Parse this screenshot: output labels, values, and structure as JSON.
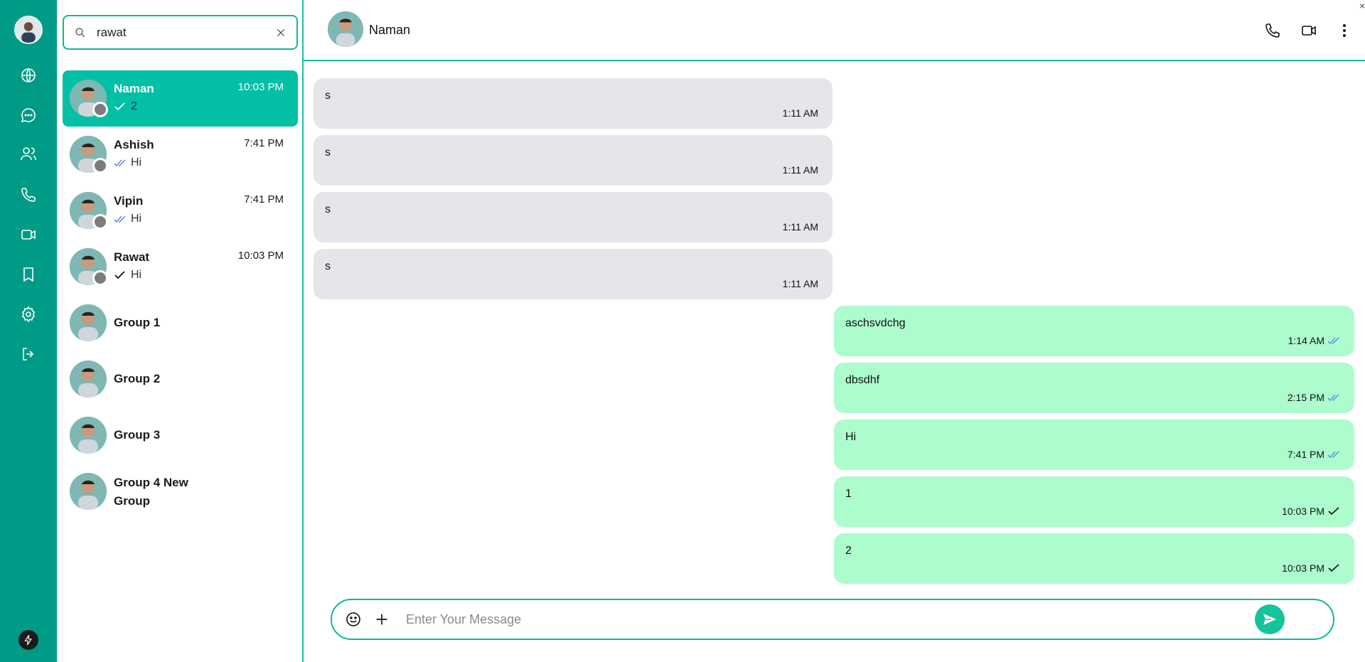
{
  "search": {
    "value": "rawat",
    "placeholder": "Search"
  },
  "chats": [
    {
      "name": "Naman",
      "time": "10:03 PM",
      "preview": "2",
      "tick": "single",
      "active": true
    },
    {
      "name": "Ashish",
      "time": "7:41 PM",
      "preview": "Hi",
      "tick": "double-blue",
      "active": false
    },
    {
      "name": "Vipin",
      "time": "7:41 PM",
      "preview": "Hi",
      "tick": "double-blue",
      "active": false
    },
    {
      "name": "Rawat",
      "time": "10:03 PM",
      "preview": "Hi",
      "tick": "single",
      "active": false
    },
    {
      "name": "Group 1"
    },
    {
      "name": "Group 2"
    },
    {
      "name": "Group 3"
    },
    {
      "name": "Group 4 New Group"
    }
  ],
  "header": {
    "name": "Naman"
  },
  "messages": [
    {
      "dir": "in",
      "text": "s",
      "time": "1:11 AM"
    },
    {
      "dir": "in",
      "text": "s",
      "time": "1:11 AM"
    },
    {
      "dir": "in",
      "text": "s",
      "time": "1:11 AM"
    },
    {
      "dir": "in",
      "text": "s",
      "time": "1:11 AM"
    },
    {
      "dir": "out",
      "text": "aschsvdchg",
      "time": "1:14 AM",
      "tick": "double-blue"
    },
    {
      "dir": "out",
      "text": "dbsdhf",
      "time": "2:15 PM",
      "tick": "double-blue"
    },
    {
      "dir": "out",
      "text": "Hi",
      "time": "7:41 PM",
      "tick": "double-blue"
    },
    {
      "dir": "out",
      "text": "1",
      "time": "10:03 PM",
      "tick": "single"
    },
    {
      "dir": "out",
      "text": "2",
      "time": "10:03 PM",
      "tick": "single"
    }
  ],
  "composer": {
    "placeholder": "Enter Your Message"
  },
  "colors": {
    "rail": "#009b86",
    "accent": "#03bfa6",
    "outgoing": "#acfccd",
    "incoming": "#e5e6ea",
    "send": "#16c49a"
  },
  "icons": [
    "globe-icon",
    "chat-icon",
    "users-icon",
    "phone-icon",
    "video-icon",
    "bookmark-icon",
    "settings-icon",
    "logout-icon",
    "bolt-icon"
  ]
}
